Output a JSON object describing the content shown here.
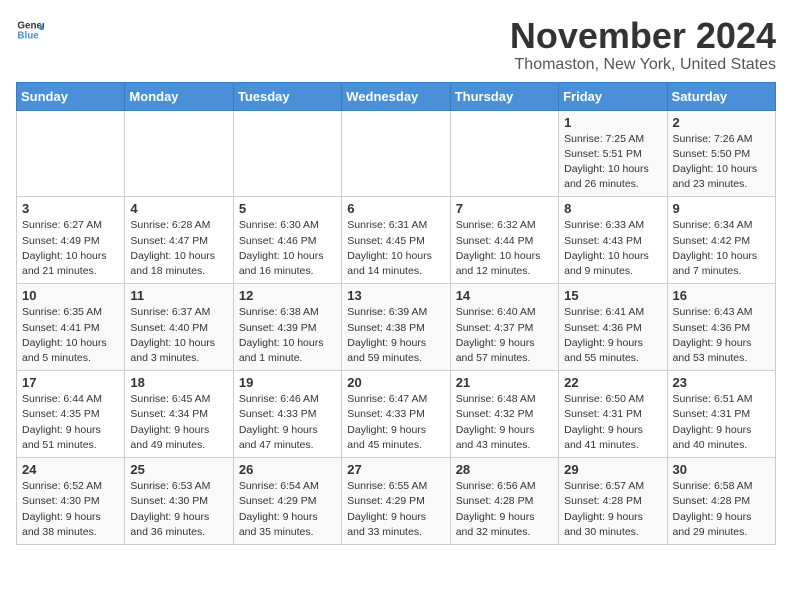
{
  "logo": {
    "text_general": "General",
    "text_blue": "Blue"
  },
  "title": {
    "month": "November 2024",
    "location": "Thomaston, New York, United States"
  },
  "weekdays": [
    "Sunday",
    "Monday",
    "Tuesday",
    "Wednesday",
    "Thursday",
    "Friday",
    "Saturday"
  ],
  "weeks": [
    [
      {
        "day": "",
        "info": ""
      },
      {
        "day": "",
        "info": ""
      },
      {
        "day": "",
        "info": ""
      },
      {
        "day": "",
        "info": ""
      },
      {
        "day": "",
        "info": ""
      },
      {
        "day": "1",
        "info": "Sunrise: 7:25 AM\nSunset: 5:51 PM\nDaylight: 10 hours and 26 minutes."
      },
      {
        "day": "2",
        "info": "Sunrise: 7:26 AM\nSunset: 5:50 PM\nDaylight: 10 hours and 23 minutes."
      }
    ],
    [
      {
        "day": "3",
        "info": "Sunrise: 6:27 AM\nSunset: 4:49 PM\nDaylight: 10 hours and 21 minutes."
      },
      {
        "day": "4",
        "info": "Sunrise: 6:28 AM\nSunset: 4:47 PM\nDaylight: 10 hours and 18 minutes."
      },
      {
        "day": "5",
        "info": "Sunrise: 6:30 AM\nSunset: 4:46 PM\nDaylight: 10 hours and 16 minutes."
      },
      {
        "day": "6",
        "info": "Sunrise: 6:31 AM\nSunset: 4:45 PM\nDaylight: 10 hours and 14 minutes."
      },
      {
        "day": "7",
        "info": "Sunrise: 6:32 AM\nSunset: 4:44 PM\nDaylight: 10 hours and 12 minutes."
      },
      {
        "day": "8",
        "info": "Sunrise: 6:33 AM\nSunset: 4:43 PM\nDaylight: 10 hours and 9 minutes."
      },
      {
        "day": "9",
        "info": "Sunrise: 6:34 AM\nSunset: 4:42 PM\nDaylight: 10 hours and 7 minutes."
      }
    ],
    [
      {
        "day": "10",
        "info": "Sunrise: 6:35 AM\nSunset: 4:41 PM\nDaylight: 10 hours and 5 minutes."
      },
      {
        "day": "11",
        "info": "Sunrise: 6:37 AM\nSunset: 4:40 PM\nDaylight: 10 hours and 3 minutes."
      },
      {
        "day": "12",
        "info": "Sunrise: 6:38 AM\nSunset: 4:39 PM\nDaylight: 10 hours and 1 minute."
      },
      {
        "day": "13",
        "info": "Sunrise: 6:39 AM\nSunset: 4:38 PM\nDaylight: 9 hours and 59 minutes."
      },
      {
        "day": "14",
        "info": "Sunrise: 6:40 AM\nSunset: 4:37 PM\nDaylight: 9 hours and 57 minutes."
      },
      {
        "day": "15",
        "info": "Sunrise: 6:41 AM\nSunset: 4:36 PM\nDaylight: 9 hours and 55 minutes."
      },
      {
        "day": "16",
        "info": "Sunrise: 6:43 AM\nSunset: 4:36 PM\nDaylight: 9 hours and 53 minutes."
      }
    ],
    [
      {
        "day": "17",
        "info": "Sunrise: 6:44 AM\nSunset: 4:35 PM\nDaylight: 9 hours and 51 minutes."
      },
      {
        "day": "18",
        "info": "Sunrise: 6:45 AM\nSunset: 4:34 PM\nDaylight: 9 hours and 49 minutes."
      },
      {
        "day": "19",
        "info": "Sunrise: 6:46 AM\nSunset: 4:33 PM\nDaylight: 9 hours and 47 minutes."
      },
      {
        "day": "20",
        "info": "Sunrise: 6:47 AM\nSunset: 4:33 PM\nDaylight: 9 hours and 45 minutes."
      },
      {
        "day": "21",
        "info": "Sunrise: 6:48 AM\nSunset: 4:32 PM\nDaylight: 9 hours and 43 minutes."
      },
      {
        "day": "22",
        "info": "Sunrise: 6:50 AM\nSunset: 4:31 PM\nDaylight: 9 hours and 41 minutes."
      },
      {
        "day": "23",
        "info": "Sunrise: 6:51 AM\nSunset: 4:31 PM\nDaylight: 9 hours and 40 minutes."
      }
    ],
    [
      {
        "day": "24",
        "info": "Sunrise: 6:52 AM\nSunset: 4:30 PM\nDaylight: 9 hours and 38 minutes."
      },
      {
        "day": "25",
        "info": "Sunrise: 6:53 AM\nSunset: 4:30 PM\nDaylight: 9 hours and 36 minutes."
      },
      {
        "day": "26",
        "info": "Sunrise: 6:54 AM\nSunset: 4:29 PM\nDaylight: 9 hours and 35 minutes."
      },
      {
        "day": "27",
        "info": "Sunrise: 6:55 AM\nSunset: 4:29 PM\nDaylight: 9 hours and 33 minutes."
      },
      {
        "day": "28",
        "info": "Sunrise: 6:56 AM\nSunset: 4:28 PM\nDaylight: 9 hours and 32 minutes."
      },
      {
        "day": "29",
        "info": "Sunrise: 6:57 AM\nSunset: 4:28 PM\nDaylight: 9 hours and 30 minutes."
      },
      {
        "day": "30",
        "info": "Sunrise: 6:58 AM\nSunset: 4:28 PM\nDaylight: 9 hours and 29 minutes."
      }
    ]
  ]
}
